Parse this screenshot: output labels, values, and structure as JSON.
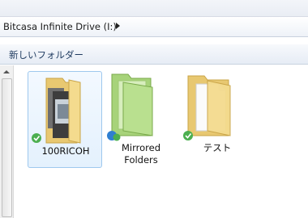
{
  "address": {
    "path": "Bitcasa Infinite Drive (I:)"
  },
  "toolbar": {
    "new_folder": "新しいフォルダー"
  },
  "items": [
    {
      "label": "100RICOH",
      "selected": true,
      "sync": "synced"
    },
    {
      "label_line1": "Mirrored",
      "label_line2": "Folders",
      "sync": "mixed"
    },
    {
      "label": "テスト",
      "sync": "synced"
    }
  ]
}
